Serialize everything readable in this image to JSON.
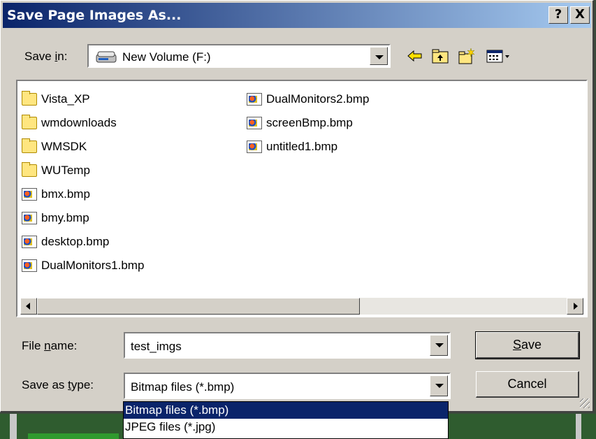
{
  "window": {
    "title": "Save Page Images As..."
  },
  "title_buttons": {
    "help": "?",
    "close": "X"
  },
  "save_in": {
    "label_pre": "Save ",
    "label_key": "i",
    "label_post": "n:",
    "value": "New Volume (F:)"
  },
  "icons": {
    "drive": "drive-icon",
    "back": "back-arrow-icon",
    "up": "up-folder-icon",
    "new_folder": "new-folder-icon",
    "views": "views-menu-icon"
  },
  "files": [
    {
      "name": "Vista_XP",
      "type": "folder"
    },
    {
      "name": "wmdownloads",
      "type": "folder"
    },
    {
      "name": "WMSDK",
      "type": "folder"
    },
    {
      "name": "WUTemp",
      "type": "folder"
    },
    {
      "name": "bmx.bmp",
      "type": "bmp"
    },
    {
      "name": "bmy.bmp",
      "type": "bmp"
    },
    {
      "name": "desktop.bmp",
      "type": "bmp"
    },
    {
      "name": "DualMonitors1.bmp",
      "type": "bmp"
    },
    {
      "name": "DualMonitors2.bmp",
      "type": "bmp"
    },
    {
      "name": "screenBmp.bmp",
      "type": "bmp"
    },
    {
      "name": "untitled1.bmp",
      "type": "bmp"
    }
  ],
  "file_name": {
    "label_pre": "File ",
    "label_key": "n",
    "label_post": "ame:",
    "value": "test_imgs"
  },
  "save_as_type": {
    "label_pre": "Save as ",
    "label_key": "t",
    "label_post": "ype:",
    "value": "Bitmap files (*.bmp)",
    "options": [
      "Bitmap files (*.bmp)",
      "JPEG files (*.jpg)"
    ]
  },
  "buttons": {
    "save_key": "S",
    "save_rest": "ave",
    "cancel": "Cancel"
  },
  "colors": {
    "title_start": "#0a246a",
    "title_end": "#a6caf0",
    "face": "#d4d0c8",
    "selection": "#0a246a"
  }
}
